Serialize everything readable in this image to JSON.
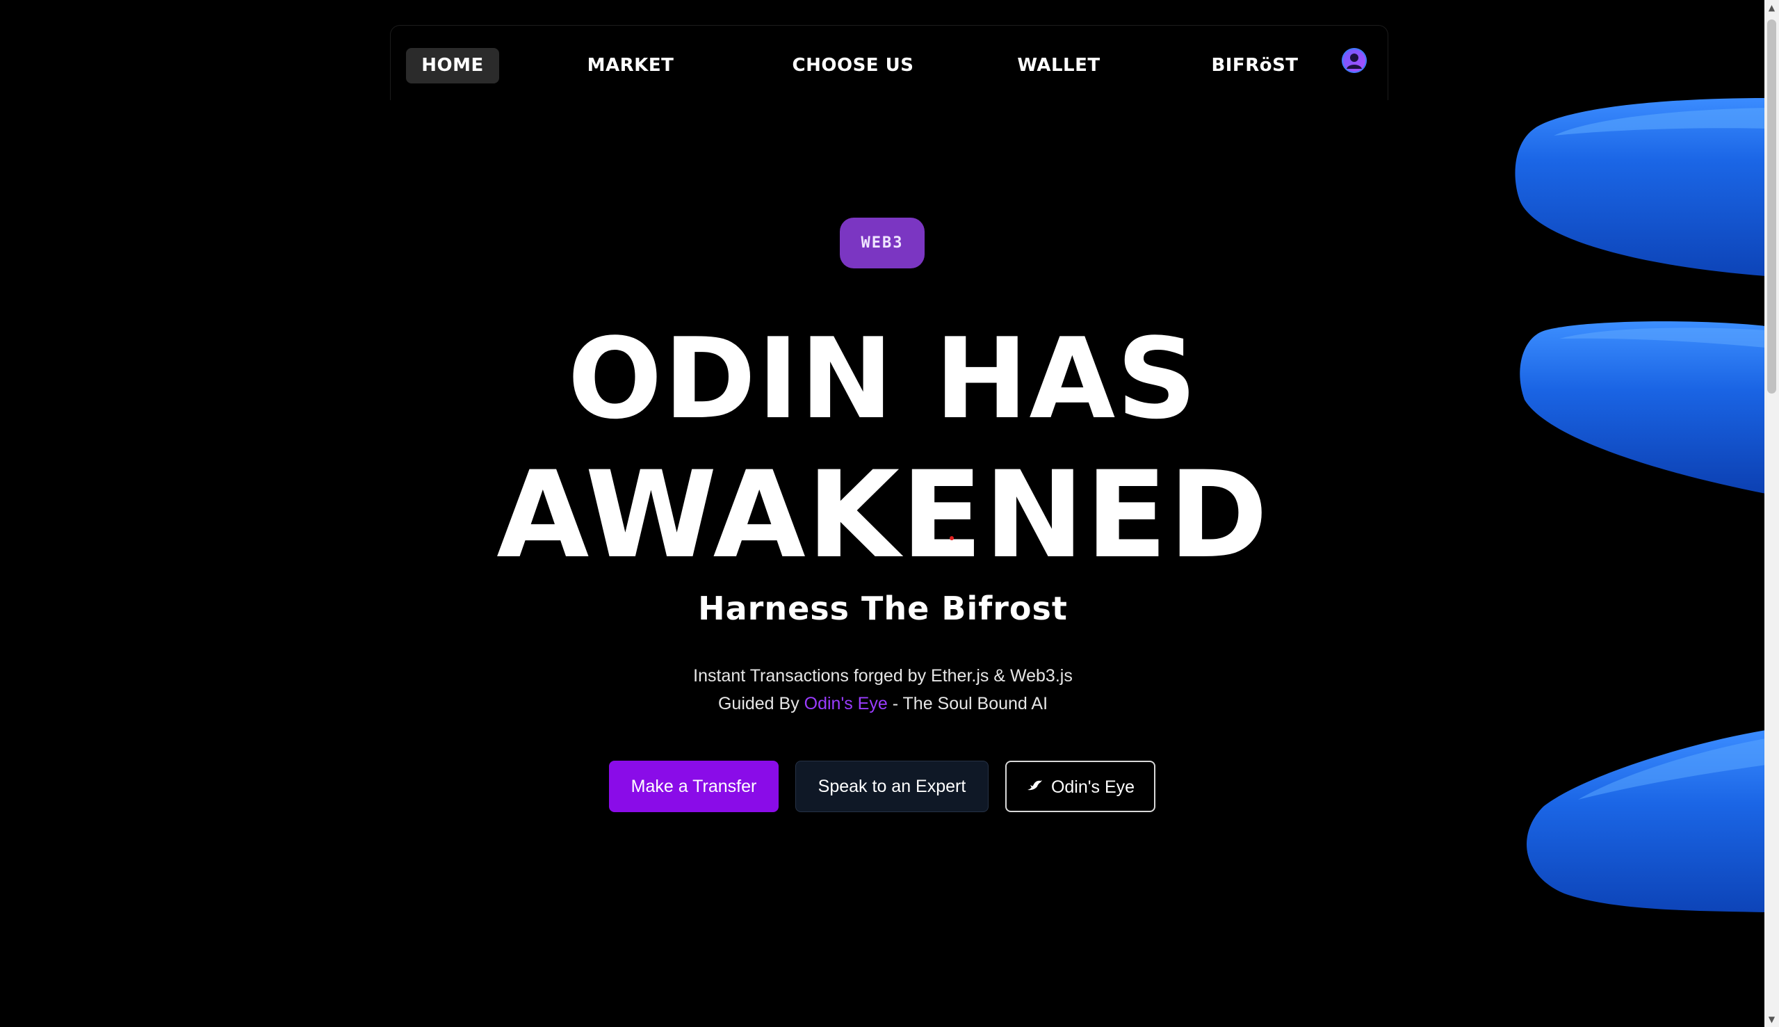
{
  "nav": {
    "items": [
      {
        "label": "HOME",
        "active": true
      },
      {
        "label": "MARKET",
        "active": false
      },
      {
        "label": "CHOOSE US",
        "active": false
      },
      {
        "label": "WALLET",
        "active": false
      },
      {
        "label": "BIFRöST",
        "active": false
      }
    ],
    "avatar_icon": "user-avatar-icon"
  },
  "hero": {
    "badge": "WEB3",
    "headline_line1": "ODIN HAS",
    "headline_line2": "AWAKENED",
    "subheadline": "Harness The Bifrost",
    "desc_line1": "Instant Transactions forged by Ether.js & Web3.js",
    "desc_line2_prefix": "Guided By ",
    "desc_line2_accent": "Odin's Eye",
    "desc_line2_suffix": " - The Soul Bound AI"
  },
  "buttons": {
    "transfer": "Make a Transfer",
    "expert": "Speak to an Expert",
    "odins_eye": "Odin's Eye",
    "odins_eye_icon": "raven-icon"
  },
  "colors": {
    "background": "#000000",
    "accent_purple": "#8a0ce8",
    "badge_purple": "#7b36c2",
    "link_purple": "#9a3cff",
    "decor_blue": "#1e6be8"
  }
}
